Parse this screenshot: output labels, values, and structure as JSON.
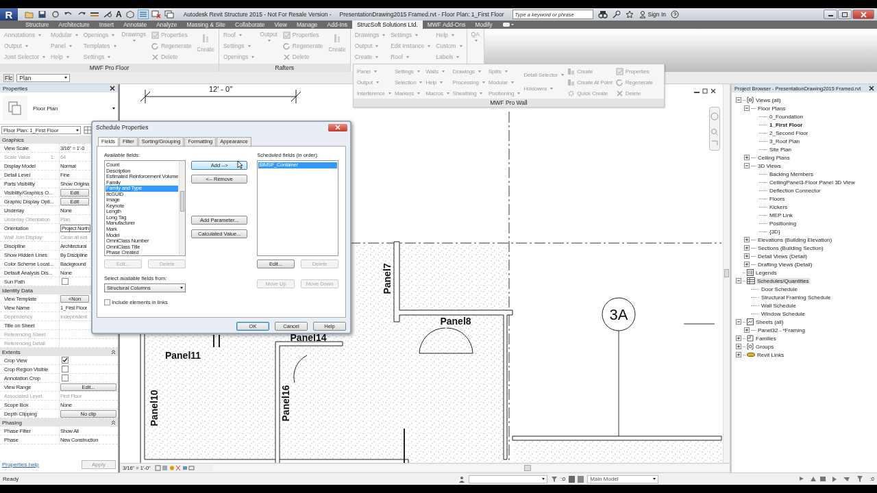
{
  "window": {
    "app_button": "R",
    "app_title": "Autodesk Revit Structure 2015 - Not For Resale Version -",
    "document_title": "PresentationDrawing2015 Framed.rvt - Floor Plan: 1_First Floor",
    "text_tool": "A",
    "search": {
      "placeholder": "Type a keyword or phrase"
    },
    "sign_in": "Sign In"
  },
  "tabs": [
    {
      "label": "Structure",
      "selected": false
    },
    {
      "label": "Architecture",
      "selected": false
    },
    {
      "label": "Insert",
      "selected": false
    },
    {
      "label": "Annotate",
      "selected": false
    },
    {
      "label": "Analyze",
      "selected": false
    },
    {
      "label": "Massing & Site",
      "selected": false
    },
    {
      "label": "Collaborate",
      "selected": false
    },
    {
      "label": "View",
      "selected": false
    },
    {
      "label": "Manage",
      "selected": false
    },
    {
      "label": "Add-Ins",
      "selected": false
    },
    {
      "label": "StrucSoft Solutions Ltd.",
      "selected": true
    },
    {
      "label": "MWF Add-Ons",
      "selected": false
    },
    {
      "label": "Modify",
      "selected": false
    }
  ],
  "ribbon": {
    "panels": [
      {
        "title": "MWF Pro Floor",
        "columns": [
          {
            "kind": "stack",
            "items": [
              {
                "label": "Annotations",
                "kind": "dropdown"
              },
              {
                "label": "Output",
                "kind": "dropdown"
              },
              {
                "label": "Joist Selector",
                "kind": "dropdown"
              }
            ]
          },
          {
            "kind": "stack",
            "items": [
              {
                "label": "Modular",
                "kind": "dropdown"
              },
              {
                "label": "Panel",
                "kind": "dropdown"
              },
              {
                "label": "Help",
                "kind": "dropdown"
              }
            ]
          },
          {
            "kind": "stack",
            "items": [
              {
                "label": "Openings",
                "kind": "dropdown"
              },
              {
                "label": "Templates",
                "kind": "dropdown"
              },
              {
                "label": "Settings",
                "kind": "dropdown"
              }
            ]
          },
          {
            "kind": "menu",
            "label": "Drawings"
          },
          {
            "kind": "stack",
            "items": [
              {
                "label": "Properties",
                "kind": "properties"
              },
              {
                "label": "Regenerate",
                "kind": "regenerate"
              },
              {
                "label": "Delete",
                "kind": "delete"
              }
            ]
          },
          {
            "kind": "button",
            "label": "Create"
          }
        ]
      },
      {
        "title": "Rafters",
        "columns": [
          {
            "kind": "stack",
            "items": [
              {
                "label": "Roof",
                "kind": "dropdown"
              },
              {
                "label": "Settings",
                "kind": "dropdown"
              },
              {
                "label": "Openings",
                "kind": "dropdown"
              }
            ]
          },
          {
            "kind": "menu",
            "label": "Output"
          },
          {
            "kind": "stack",
            "items": [
              {
                "label": "Properties",
                "kind": "properties"
              },
              {
                "label": "Regenerate",
                "kind": "regenerate"
              },
              {
                "label": "Delete",
                "kind": "delete"
              }
            ]
          },
          {
            "kind": "button",
            "label": "Create"
          }
        ]
      },
      {
        "columns": [
          {
            "kind": "stack",
            "items": [
              {
                "label": "Drawings",
                "kind": "dropdown"
              },
              {
                "label": "Output",
                "kind": "dropdown"
              },
              {
                "label": "Create",
                "kind": "dropdown"
              }
            ]
          },
          {
            "kind": "stack",
            "items": [
              {
                "label": "Settings",
                "kind": "dropdown"
              },
              {
                "label": "Edit Instance",
                "kind": "dropdown"
              },
              {
                "label": "Roof",
                "kind": "dropdown"
              }
            ]
          },
          {
            "kind": "stack",
            "items": [
              {
                "label": "Help",
                "kind": "dropdown"
              },
              {
                "label": "Custom",
                "kind": "dropdown"
              },
              {
                "label": "Labels",
                "kind": "dropdown"
              }
            ]
          }
        ]
      },
      {
        "columns": [
          {
            "kind": "menu",
            "label": "QA"
          }
        ]
      }
    ]
  },
  "floating_panel": {
    "title": "MWF Pro Wall",
    "columns": [
      {
        "kind": "stack",
        "items": [
          {
            "label": "Panel",
            "kind": "dropdown"
          },
          {
            "label": "Output",
            "kind": "dropdown"
          },
          {
            "label": "Interference",
            "kind": "dropdown"
          }
        ]
      },
      {
        "kind": "stack",
        "items": [
          {
            "label": "Settings",
            "kind": "dropdown"
          },
          {
            "label": "Selection",
            "kind": "dropdown"
          },
          {
            "label": "Markers",
            "kind": "dropdown"
          }
        ]
      },
      {
        "kind": "stack",
        "items": [
          {
            "label": "Walls",
            "kind": "dropdown"
          },
          {
            "label": "Help",
            "kind": "dropdown"
          },
          {
            "label": "Macros",
            "kind": "dropdown"
          }
        ]
      },
      {
        "kind": "stack",
        "items": [
          {
            "label": "Drawings",
            "kind": "dropdown"
          },
          {
            "label": "Processing",
            "kind": "dropdown"
          },
          {
            "label": "Sheathing",
            "kind": "dropdown"
          }
        ]
      },
      {
        "kind": "stack",
        "items": [
          {
            "label": "Splits",
            "kind": "dropdown"
          },
          {
            "label": "Modular",
            "kind": "dropdown"
          },
          {
            "label": "Positioning",
            "kind": "dropdown"
          }
        ]
      },
      {
        "kind": "stack",
        "items": [
          {
            "label": "Detail Selector",
            "kind": "dropdown"
          },
          {
            "label": "Holdowns",
            "kind": "dropdown"
          }
        ]
      },
      {
        "kind": "stack",
        "items": [
          {
            "label": "Create",
            "kind": "create"
          },
          {
            "label": "Create At Point",
            "kind": "create"
          },
          {
            "label": "Quick Create",
            "kind": "quick"
          }
        ]
      },
      {
        "kind": "stack",
        "items": [
          {
            "label": "Properties",
            "kind": "properties"
          },
          {
            "label": "Regenerate",
            "kind": "regenerate"
          },
          {
            "label": "Delete",
            "kind": "delete"
          }
        ]
      }
    ]
  },
  "options_bar": {
    "label": "Flc",
    "value": "Plan"
  },
  "properties": {
    "title": "Properties",
    "type_name": "Floor Plan",
    "instance": "Floor Plan: 1_First Floor",
    "groups": [
      {
        "name": "Graphics",
        "collapse_icon": false,
        "rows": [
          {
            "name": "View Scale",
            "value": "3/16\" = 1'-0",
            "kind": "text",
            "disabled": false
          },
          {
            "name": "Scale Value",
            "unit": "1:",
            "value": "64",
            "kind": "text",
            "disabled": true
          },
          {
            "name": "Display Model",
            "value": "Normal",
            "kind": "text",
            "disabled": false
          },
          {
            "name": "Detail Level",
            "value": "Fine",
            "kind": "text",
            "disabled": false
          },
          {
            "name": "Parts Visibility",
            "value": "Show Origina",
            "kind": "text",
            "disabled": false
          },
          {
            "name": "Visibility/Graphics O...",
            "value": "Edit",
            "kind": "button",
            "disabled": false
          },
          {
            "name": "Graphic Display Opti...",
            "value": "Edit",
            "kind": "button",
            "disabled": false
          },
          {
            "name": "Underlay",
            "value": "None",
            "kind": "text",
            "disabled": false
          },
          {
            "name": "Underlay Orientation",
            "value": "Plan",
            "kind": "text",
            "disabled": true
          },
          {
            "name": "Orientation",
            "value": "Project North",
            "kind": "field",
            "disabled": false
          },
          {
            "name": "Wall Join Display",
            "value": "Clean all wal",
            "kind": "text",
            "disabled": true
          },
          {
            "name": "Discipline",
            "value": "Architectural",
            "kind": "text",
            "disabled": false
          },
          {
            "name": "Show Hidden Lines",
            "value": "By Discipline",
            "kind": "text",
            "disabled": false
          },
          {
            "name": "Color Scheme Locat...",
            "value": "Background",
            "kind": "text",
            "disabled": false
          },
          {
            "name": "Default Analysis Dis...",
            "value": "None",
            "kind": "text",
            "disabled": false
          },
          {
            "name": "Sun Path",
            "kind": "checkbox",
            "checked": false,
            "disabled": false
          }
        ]
      },
      {
        "name": "Identity Data",
        "collapse_icon": false,
        "rows": [
          {
            "name": "View Template",
            "value": "<Non",
            "kind": "button",
            "disabled": false
          },
          {
            "name": "View Name",
            "value": "1_First Floor",
            "kind": "text",
            "disabled": false
          },
          {
            "name": "Dependency",
            "value": "Independent",
            "kind": "text",
            "disabled": true
          },
          {
            "name": "Title on Sheet",
            "kind": "text",
            "disabled": false
          },
          {
            "name": "Referencing Sheet",
            "kind": "text",
            "disabled": true
          },
          {
            "name": "Referencing Detail",
            "kind": "text",
            "disabled": true
          }
        ]
      },
      {
        "name": "Extents",
        "collapse_icon": true,
        "rows": [
          {
            "name": "Crop View",
            "kind": "checkbox",
            "checked": true,
            "disabled": false
          },
          {
            "name": "Crop Region Visible",
            "kind": "checkbox",
            "checked": false,
            "disabled": false
          },
          {
            "name": "Annotation Crop",
            "kind": "checkbox",
            "checked": false,
            "disabled": false
          },
          {
            "name": "View Range",
            "value": "Edit...",
            "kind": "button",
            "disabled": false
          },
          {
            "name": "Associated Level",
            "value": "First Floor",
            "kind": "text",
            "disabled": true
          },
          {
            "name": "Scope Box",
            "value": "None",
            "kind": "text",
            "disabled": false
          },
          {
            "name": "Depth Clipping",
            "value": "No clip",
            "kind": "button",
            "disabled": false
          }
        ]
      },
      {
        "name": "Phasing",
        "collapse_icon": true,
        "rows": [
          {
            "name": "Phase Filter",
            "value": "Show All",
            "kind": "text",
            "disabled": false
          },
          {
            "name": "Phase",
            "value": "New Construction",
            "kind": "text",
            "disabled": false
          }
        ]
      }
    ],
    "help_link": "Properties help",
    "apply": "Apply"
  },
  "view": {
    "dimension": "12' - 0\"",
    "labels": [
      "Panel7",
      "Panel8",
      "Panel14",
      "Panel11",
      "Panel10",
      "Panel16"
    ],
    "grid_bubble": "3A",
    "scale": "3/16\" = 1'-0\""
  },
  "dialog": {
    "title": "Schedule Properties",
    "tabs": [
      {
        "label": "Fields",
        "selected": true
      },
      {
        "label": "Filter",
        "selected": false
      },
      {
        "label": "Sorting/Grouping",
        "selected": false
      },
      {
        "label": "Formatting",
        "selected": false
      },
      {
        "label": "Appearance",
        "selected": false
      }
    ],
    "available_label": "Available fields:",
    "available_fields": [
      {
        "label": "Count",
        "selected": false
      },
      {
        "label": "Description",
        "selected": false
      },
      {
        "label": "Estimated Reinforcement Volume",
        "selected": false
      },
      {
        "label": "Family",
        "selected": false
      },
      {
        "label": "Family and Type",
        "selected": true
      },
      {
        "label": "IfcGUID",
        "selected": false
      },
      {
        "label": "Image",
        "selected": false
      },
      {
        "label": "Keynote",
        "selected": false
      },
      {
        "label": "Length",
        "selected": false
      },
      {
        "label": "Long Tag",
        "selected": false
      },
      {
        "label": "Manufacturer",
        "selected": false
      },
      {
        "label": "Mark",
        "selected": false
      },
      {
        "label": "Model",
        "selected": false
      },
      {
        "label": "OmniClass Number",
        "selected": false
      },
      {
        "label": "OmniClass Title",
        "selected": false
      },
      {
        "label": "Phase Created",
        "selected": false
      }
    ],
    "left_buttons": [
      {
        "label": "Edit...",
        "disabled": true
      },
      {
        "label": "Delete",
        "disabled": true
      }
    ],
    "source_label": "Select available fields from:",
    "source_value": "Structural Columns",
    "include_links": {
      "label": "Include elements in links",
      "checked": false
    },
    "middle_buttons": [
      {
        "label": "Add -->",
        "hovered": true
      },
      {
        "label": "<-- Remove",
        "hovered": false
      },
      {
        "label": "Add Parameter...",
        "hovered": false
      },
      {
        "label": "Calculated Value...",
        "hovered": false
      }
    ],
    "scheduled_label": "Scheduled fields (in order):",
    "scheduled_fields": [
      {
        "label": "BIMSF_Container",
        "selected": true
      }
    ],
    "right_buttons": [
      {
        "label": "Edit...",
        "disabled": false
      },
      {
        "label": "Delete",
        "disabled": true
      }
    ],
    "move_buttons": [
      {
        "label": "Move Up",
        "disabled": true
      },
      {
        "label": "Move Down",
        "disabled": true
      }
    ],
    "footer_buttons": [
      {
        "label": "OK",
        "default": true
      },
      {
        "label": "Cancel",
        "default": false
      },
      {
        "label": "Help",
        "default": false
      }
    ]
  },
  "project_browser": {
    "title": "Project Browser - PresentationDrawing2015 Framed.rvt",
    "tree": [
      {
        "label": "Views (all)",
        "kind": "views",
        "expanded": true,
        "selected": false,
        "current": false,
        "children": [
          {
            "label": "Floor Plans",
            "kind": "folder",
            "expanded": true,
            "selected": false,
            "current": false,
            "children": [
              {
                "label": "0_Foundation",
                "kind": "leaf",
                "selected": false,
                "current": false
              },
              {
                "label": "1_First Floor",
                "kind": "leaf",
                "selected": false,
                "current": true
              },
              {
                "label": "2_Second Floor",
                "kind": "leaf",
                "selected": false,
                "current": false
              },
              {
                "label": "3_Roof Plan",
                "kind": "leaf",
                "selected": false,
                "current": false
              },
              {
                "label": "Site Plan",
                "kind": "leaf",
                "selected": false,
                "current": false
              }
            ]
          },
          {
            "label": "Ceiling Plans",
            "kind": "folder",
            "expanded": false,
            "selected": false,
            "current": false
          },
          {
            "label": "3D Views",
            "kind": "folder",
            "expanded": true,
            "selected": false,
            "current": false,
            "children": [
              {
                "label": "Backing Members",
                "kind": "leaf",
                "selected": false,
                "current": false
              },
              {
                "label": "CeilingPanel3-Floor Panel 3D View",
                "kind": "leaf",
                "selected": false,
                "current": false
              },
              {
                "label": "Deflection Connector",
                "kind": "leaf",
                "selected": false,
                "current": false
              },
              {
                "label": "Floors",
                "kind": "leaf",
                "selected": false,
                "current": false
              },
              {
                "label": "Kickers",
                "kind": "leaf",
                "selected": false,
                "current": false
              },
              {
                "label": "MEP Link",
                "kind": "leaf",
                "selected": false,
                "current": false
              },
              {
                "label": "Positioning",
                "kind": "leaf",
                "selected": false,
                "current": false
              },
              {
                "label": "{3D}",
                "kind": "leaf",
                "selected": false,
                "current": false
              }
            ]
          },
          {
            "label": "Elevations (Building Elevation)",
            "kind": "folder",
            "expanded": false,
            "selected": false,
            "current": false
          },
          {
            "label": "Sections (Building Section)",
            "kind": "folder",
            "expanded": false,
            "selected": false,
            "current": false
          },
          {
            "label": "Detail Views (Detail)",
            "kind": "folder",
            "expanded": false,
            "selected": false,
            "current": false
          },
          {
            "label": "Drafting Views (Detail)",
            "kind": "folder",
            "expanded": false,
            "selected": false,
            "current": false
          }
        ]
      },
      {
        "label": "Legends",
        "kind": "legends",
        "selected": false,
        "current": false
      },
      {
        "label": "Schedules/Quantities",
        "kind": "schedules",
        "expanded": true,
        "selected": true,
        "current": false,
        "children": [
          {
            "label": "Door Schedule",
            "kind": "leaf",
            "selected": false,
            "current": false
          },
          {
            "label": "Structural Framing Schedule",
            "kind": "leaf",
            "selected": false,
            "current": false
          },
          {
            "label": "Wall Schedule",
            "kind": "leaf",
            "selected": false,
            "current": false
          },
          {
            "label": "Window Schedule",
            "kind": "leaf",
            "selected": false,
            "current": false
          }
        ]
      },
      {
        "label": "Sheets (all)",
        "kind": "sheets",
        "expanded": true,
        "selected": false,
        "current": false,
        "children": [
          {
            "label": "Panel32 - *Framing",
            "kind": "folder",
            "expanded": false,
            "selected": false,
            "current": false
          }
        ]
      },
      {
        "label": "Families",
        "kind": "families",
        "expanded": false,
        "selected": false,
        "current": false
      },
      {
        "label": "Groups",
        "kind": "groups",
        "expanded": false,
        "selected": false,
        "current": false
      },
      {
        "label": "Revit Links",
        "kind": "links",
        "expanded": false,
        "selected": false,
        "current": false
      }
    ]
  },
  "status_bar": {
    "text": "Ready",
    "selection_count": ":0",
    "model": "Main Model",
    "filter_count": ":0"
  }
}
